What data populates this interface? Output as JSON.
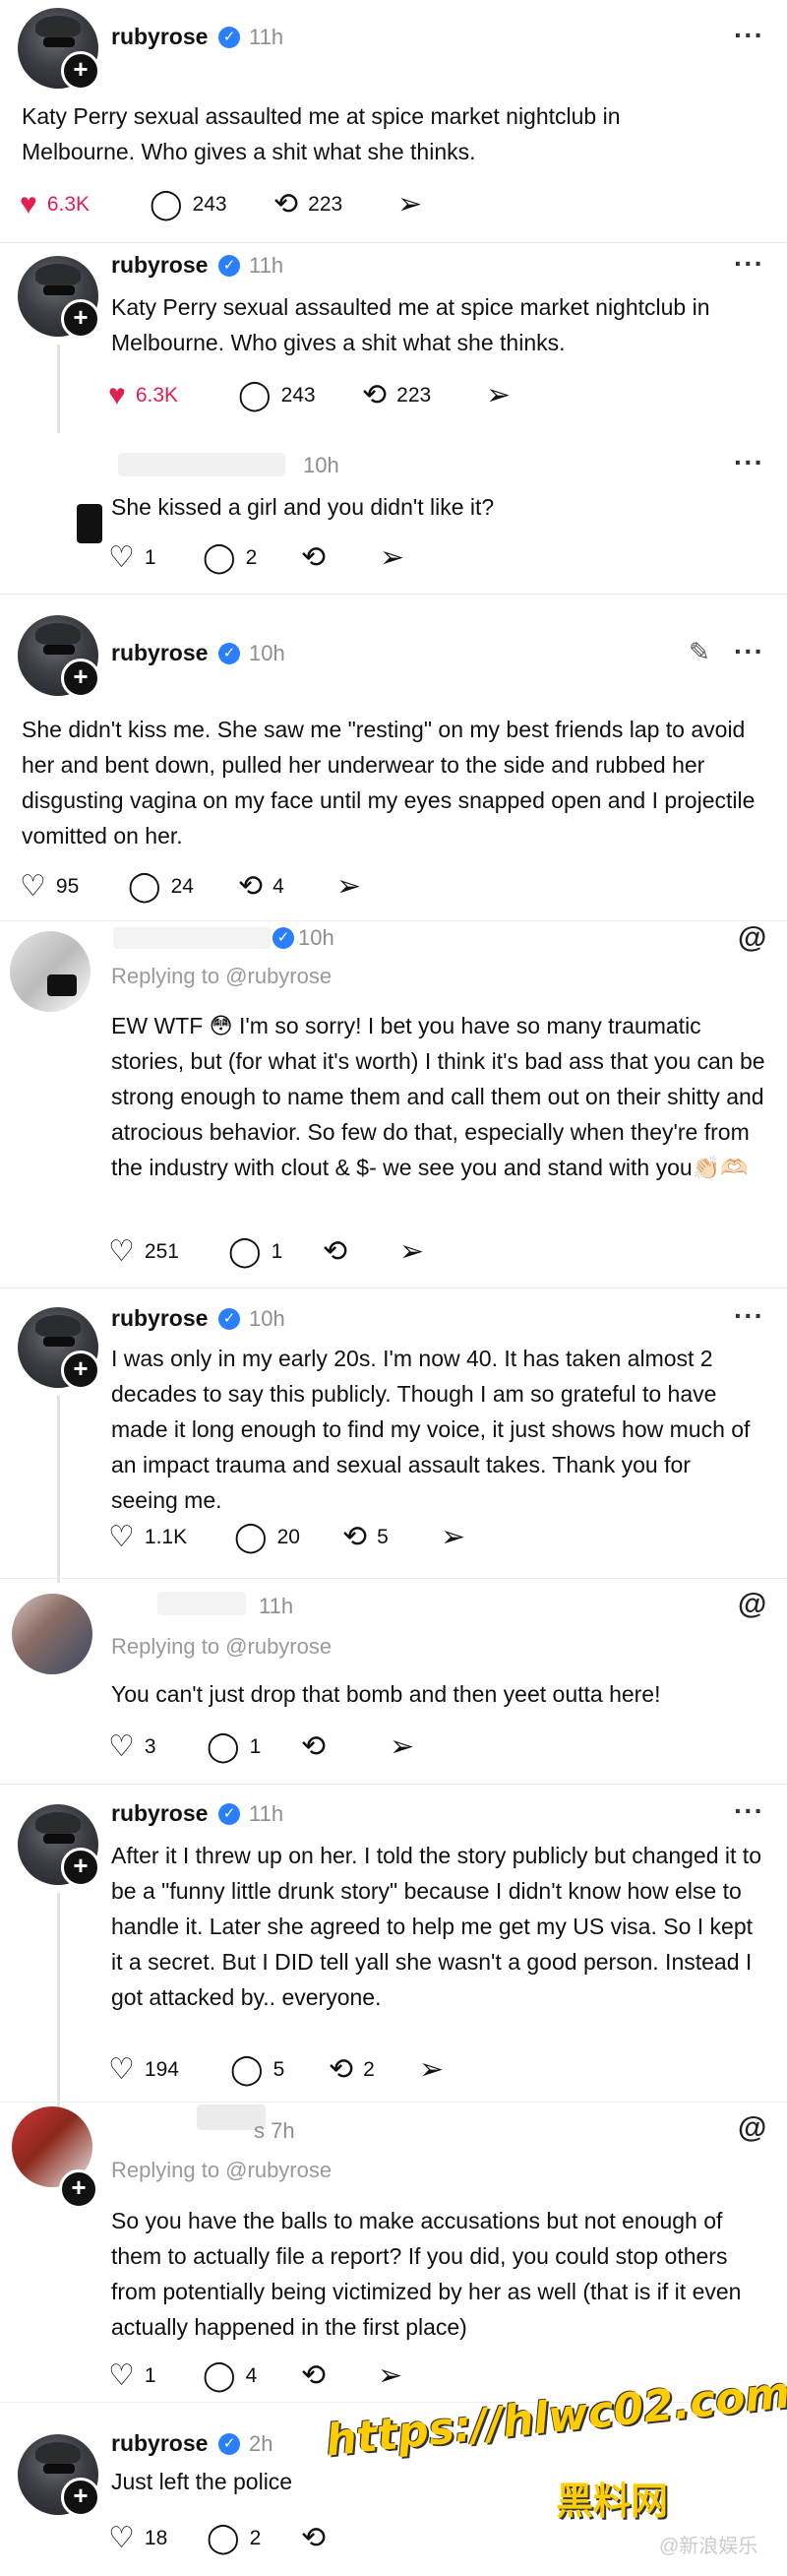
{
  "posts": [
    {
      "username": "rubyrose",
      "time": "11h",
      "text": "Katy Perry sexual assaulted me at spice market nightclub in Melbourne. Who gives a shit what she thinks.",
      "likes": "6.3K",
      "replies": "243",
      "reposts": "223"
    },
    {
      "username": "rubyrose",
      "time": "11h",
      "text": "Katy Perry sexual assaulted me at spice market nightclub in Melbourne. Who gives a shit what she thinks.",
      "likes": "6.3K",
      "replies": "243",
      "reposts": "223"
    },
    {
      "username": "",
      "time": "10h",
      "text": "She kissed a girl and you didn't like it?",
      "likes": "1",
      "replies": "2"
    },
    {
      "username": "rubyrose",
      "time": "10h",
      "text": "She didn't kiss me. She saw me \"resting\" on my best friends lap to avoid her and bent down, pulled her underwear to the side and rubbed her disgusting vagina on my face until my eyes snapped open and I projectile vomitted on her.",
      "likes": "95",
      "replies": "24",
      "reposts": "4"
    },
    {
      "time": "10h",
      "replying": "Replying to @rubyrose",
      "text": "EW WTF 😳 I'm so sorry! I bet you have so many traumatic stories, but (for what it's worth) I think it's bad ass that you can be strong enough to name them and call them out on their shitty and atrocious behavior. So few do that, especially when they're from the industry with clout & $- we see you and stand with you👏🏻🫶🏻",
      "likes": "251",
      "replies": "1"
    },
    {
      "username": "rubyrose",
      "time": "10h",
      "text": "I was only in my early 20s. I'm now 40. It has taken almost 2 decades to say this publicly. Though I am so grateful to have made it long enough to find my voice, it just shows how much of an impact trauma and sexual assault takes. Thank you for seeing me.",
      "likes": "1.1K",
      "replies": "20",
      "reposts": "5"
    },
    {
      "time": "11h",
      "replying": "Replying to @rubyrose",
      "text": "You can't just drop that bomb and then yeet outta here!",
      "likes": "3",
      "replies": "1"
    },
    {
      "username": "rubyrose",
      "time": "11h",
      "text": "After it I threw up on her. I told the story publicly but changed it to be a \"funny little drunk story\" because I didn't know how else to handle it. Later she agreed to help me get my US visa. So I kept it a secret. But I DID tell yall she wasn't a good person. Instead I got attacked by.. everyone.",
      "likes": "194",
      "replies": "5",
      "reposts": "2"
    },
    {
      "time": "s 7h",
      "replying": "Replying to @rubyrose",
      "text": "So you have the balls to make accusations but not enough of them to actually file a report? If you did, you could stop others from potentially being victimized by her as well (that is if it even actually happened in the first place)",
      "likes": "1",
      "replies": "4"
    },
    {
      "username": "rubyrose",
      "time": "2h",
      "text": "Just left the police",
      "likes": "18",
      "replies": "2"
    }
  ],
  "watermark": {
    "line1": "https://hlwc02.com",
    "line2": "黑料网",
    "line3": "@新浪娱乐"
  },
  "icons": {
    "heart": "heart-icon",
    "reply": "comment-icon",
    "repost": "repost-icon",
    "share": "share-icon",
    "more": "more-icon",
    "threads": "threads-icon",
    "verified": "verified-badge-icon"
  }
}
